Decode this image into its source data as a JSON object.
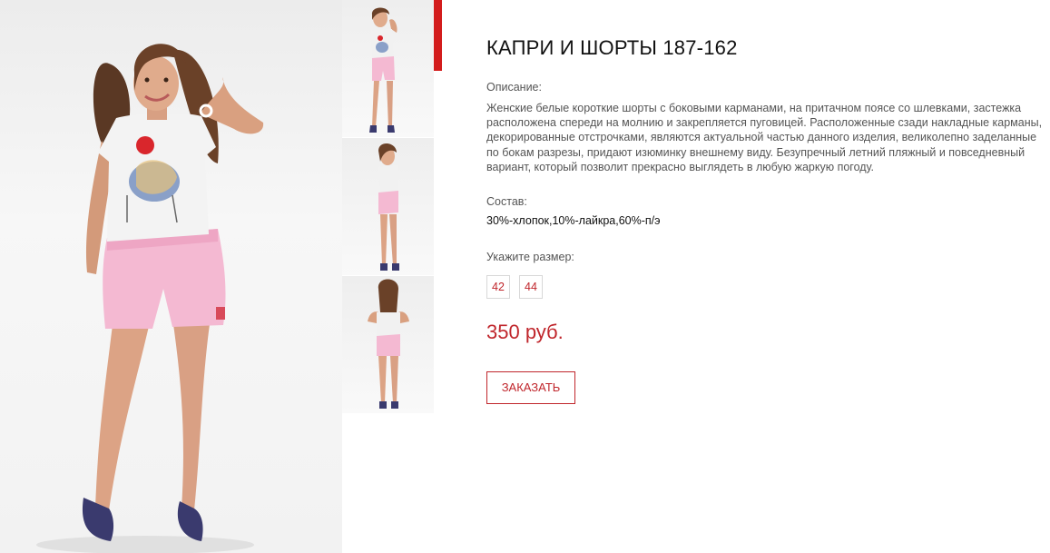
{
  "colors": {
    "accent": "#c0262c",
    "active_indicator": "#d31c1c",
    "text_dark": "#111111",
    "text_muted": "#555555",
    "border": "#d8d8d8",
    "shorts_pink": "#f4b9d2",
    "shoes_navy": "#3a3a6e"
  },
  "product": {
    "title": "КАПРИ И ШОРТЫ 187-162",
    "description_label": "Описание:",
    "description": "Женские белые короткие шорты с боковыми карманами, на притачном поясе со шлевками, застежка расположена спереди на молнию и закрепляется пуговицей. Расположенные сзади накладные карманы, декорированные отстрочками, являются актуальной частью данного изделия, великолепно заделанные по бокам разрезы, придают изюминку внешнему виду. Безупречный летний пляжный и повседневный вариант, который позволит прекрасно выглядеть в любую жаркую погоду.",
    "composition_label": "Состав:",
    "composition": "30%-хлопок,10%-лайкра,60%-п/э",
    "size_label": "Укажите размер:",
    "sizes": [
      "42",
      "44"
    ],
    "price": "350 руб.",
    "order_button": "ЗАКАЗАТЬ"
  },
  "gallery": {
    "main_image": "model-front-photo",
    "thumbnails": [
      "model-front-thumbnail",
      "model-side-thumbnail",
      "model-back-thumbnail"
    ],
    "active_index": 0
  }
}
